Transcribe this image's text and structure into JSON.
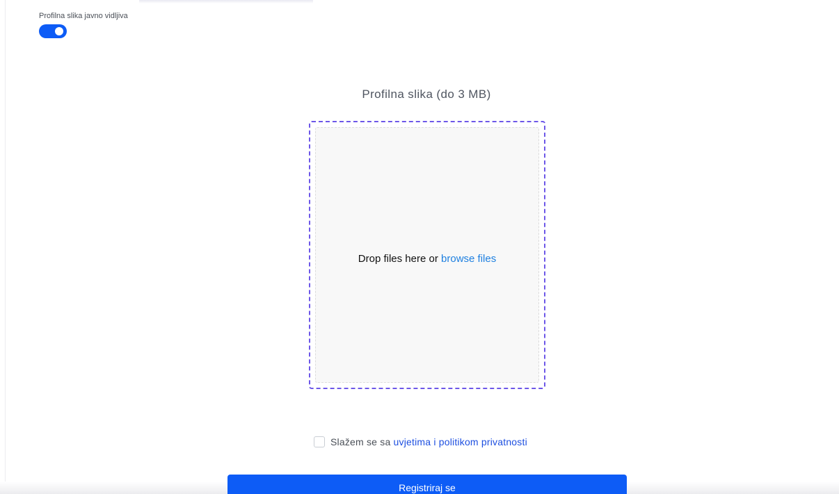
{
  "profile": {
    "visibility_label": "Profilna slika javno vidljiva",
    "visibility_enabled": true
  },
  "upload": {
    "title": "Profilna slika (do 3 MB)",
    "drop_text": "Drop files here or",
    "browse_link": "browse files"
  },
  "terms": {
    "prefix": "Slažem se sa",
    "link": "uvjetima i politikom privatnosti",
    "checked": false
  },
  "register_button": "Registriraj se",
  "colors": {
    "accent": "#0d5cf6",
    "dropzone_border": "#6d57e8",
    "link": "#1f80e0"
  }
}
